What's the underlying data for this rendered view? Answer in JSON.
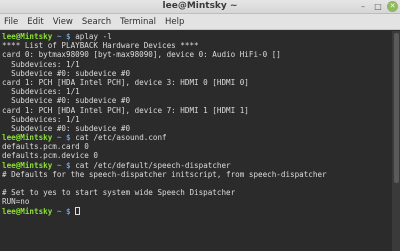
{
  "window": {
    "title": "lee@Mintsky ~"
  },
  "controls": {
    "minimize": "–",
    "maximize": "□",
    "close": "✕"
  },
  "menu": [
    "File",
    "Edit",
    "View",
    "Search",
    "Terminal",
    "Help"
  ],
  "terminal": {
    "prompt_user": "lee@Mintsky",
    "prompt_path": "~",
    "prompt_symbol": "$",
    "lines": [
      {
        "type": "cmd",
        "text": "aplay -l"
      },
      {
        "type": "out",
        "text": "**** List of PLAYBACK Hardware Devices ****"
      },
      {
        "type": "out",
        "text": "card 0: bytmax98090 [byt-max98090], device 0: Audio HiFi-0 []"
      },
      {
        "type": "out",
        "text": "  Subdevices: 1/1"
      },
      {
        "type": "out",
        "text": "  Subdevice #0: subdevice #0"
      },
      {
        "type": "out",
        "text": "card 1: PCH [HDA Intel PCH], device 3: HDMI 0 [HDMI 0]"
      },
      {
        "type": "out",
        "text": "  Subdevices: 1/1"
      },
      {
        "type": "out",
        "text": "  Subdevice #0: subdevice #0"
      },
      {
        "type": "out",
        "text": "card 1: PCH [HDA Intel PCH], device 7: HDMI 1 [HDMI 1]"
      },
      {
        "type": "out",
        "text": "  Subdevices: 1/1"
      },
      {
        "type": "out",
        "text": "  Subdevice #0: subdevice #0"
      },
      {
        "type": "cmd",
        "text": "cat /etc/asound.conf"
      },
      {
        "type": "out",
        "text": "defaults.pcm.card 0"
      },
      {
        "type": "out",
        "text": "defaults.pcm.device 0"
      },
      {
        "type": "cmd",
        "text": "cat /etc/default/speech-dispatcher"
      },
      {
        "type": "out",
        "text": "# Defaults for the speech-dispatcher initscript, from speech-dispatcher"
      },
      {
        "type": "out",
        "text": ""
      },
      {
        "type": "out",
        "text": "# Set to yes to start system wide Speech Dispatcher"
      },
      {
        "type": "out",
        "text": "RUN=no"
      },
      {
        "type": "prompt",
        "text": ""
      }
    ]
  }
}
